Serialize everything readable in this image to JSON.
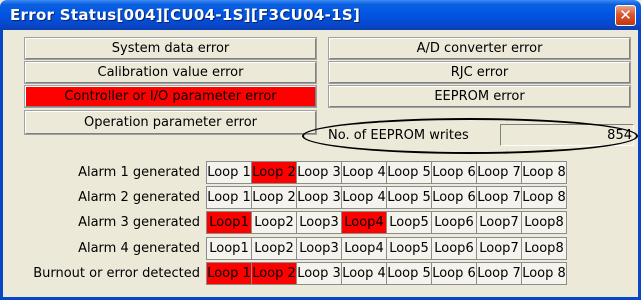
{
  "window": {
    "title": "Error Status[004][CU04-1S][F3CU04-1S]",
    "close_glyph": "✕",
    "accent_color": "#0054e3",
    "error_color": "#ff0000"
  },
  "status": {
    "left": [
      {
        "label": "System data error",
        "active": false
      },
      {
        "label": "Calibration value error",
        "active": false
      },
      {
        "label": "Controller or I/O parameter error",
        "active": true
      },
      {
        "label": "Operation parameter error",
        "active": false
      }
    ],
    "right": [
      {
        "label": "A/D converter error",
        "active": false
      },
      {
        "label": "RJC error",
        "active": false
      },
      {
        "label": "EEPROM error",
        "active": false
      }
    ]
  },
  "eeprom_writes": {
    "label": "No. of EEPROM writes",
    "value": "854"
  },
  "alarms": {
    "rows": [
      {
        "label": "Alarm 1 generated",
        "loops": [
          "Loop 1",
          "Loop 2",
          "Loop 3",
          "Loop 4",
          "Loop 5",
          "Loop 6",
          "Loop 7",
          "Loop 8"
        ],
        "active": [
          false,
          true,
          false,
          false,
          false,
          false,
          false,
          false
        ]
      },
      {
        "label": "Alarm 2 generated",
        "loops": [
          "Loop 1",
          "Loop 2",
          "Loop 3",
          "Loop 4",
          "Loop 5",
          "Loop 6",
          "Loop 7",
          "Loop 8"
        ],
        "active": [
          false,
          false,
          false,
          false,
          false,
          false,
          false,
          false
        ]
      },
      {
        "label": "Alarm 3 generated",
        "loops": [
          "Loop1",
          "Loop2",
          "Loop3",
          "Loop4",
          "Loop5",
          "Loop6",
          "Loop7",
          "Loop8"
        ],
        "active": [
          true,
          false,
          false,
          true,
          false,
          false,
          false,
          false
        ]
      },
      {
        "label": "Alarm 4 generated",
        "loops": [
          "Loop1",
          "Loop2",
          "Loop3",
          "Loop4",
          "Loop5",
          "Loop6",
          "Loop7",
          "Loop8"
        ],
        "active": [
          false,
          false,
          false,
          false,
          false,
          false,
          false,
          false
        ]
      },
      {
        "label": "Burnout or error detected",
        "loops": [
          "Loop 1",
          "Loop 2",
          "Loop 3",
          "Loop 4",
          "Loop 5",
          "Loop 6",
          "Loop 7",
          "Loop 8"
        ],
        "active": [
          true,
          true,
          false,
          false,
          false,
          false,
          false,
          false
        ]
      }
    ]
  }
}
